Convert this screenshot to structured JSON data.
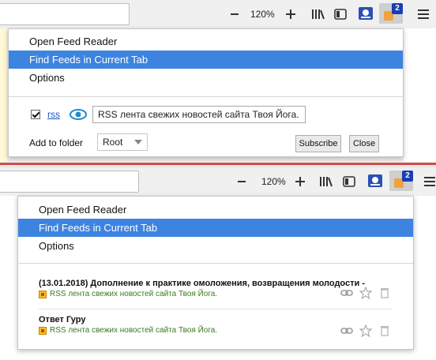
{
  "colors": {
    "accent": "#3d84e0",
    "badge": "#1a3db5",
    "feed_text": "#3a7a1f",
    "separator": "#c9302c"
  },
  "toolbar": {
    "zoom": "120%",
    "badge_count": "2",
    "icons": [
      "zoom-out-icon",
      "zoom-in-icon",
      "library-icon",
      "sidebar-icon",
      "screenshot-icon",
      "feed-reader-icon",
      "hamburger-menu-icon"
    ]
  },
  "top": {
    "menu": [
      "Open Feed Reader",
      "Find Feeds in Current Tab",
      "Options"
    ],
    "selected_index": 1,
    "feed": {
      "link": "rss",
      "title": "RSS лента свежих новостей сайта Твоя Йога.",
      "checked": true
    },
    "folder_label": "Add to folder",
    "folder_value": "Root",
    "subscribe": "Subscribe",
    "close": "Close"
  },
  "bottom": {
    "menu": [
      "Open Feed Reader",
      "Find Feeds in Current Tab",
      "Options"
    ],
    "selected_index": 1,
    "items": [
      {
        "title": "(13.01.2018) Дополнение к практике омоложения, возвращения молодости -",
        "feed": "RSS лента свежих новостей сайта Твоя Йога."
      },
      {
        "title": "Ответ Гуру",
        "feed": "RSS лента свежих новостей сайта Твоя Йога."
      }
    ]
  }
}
